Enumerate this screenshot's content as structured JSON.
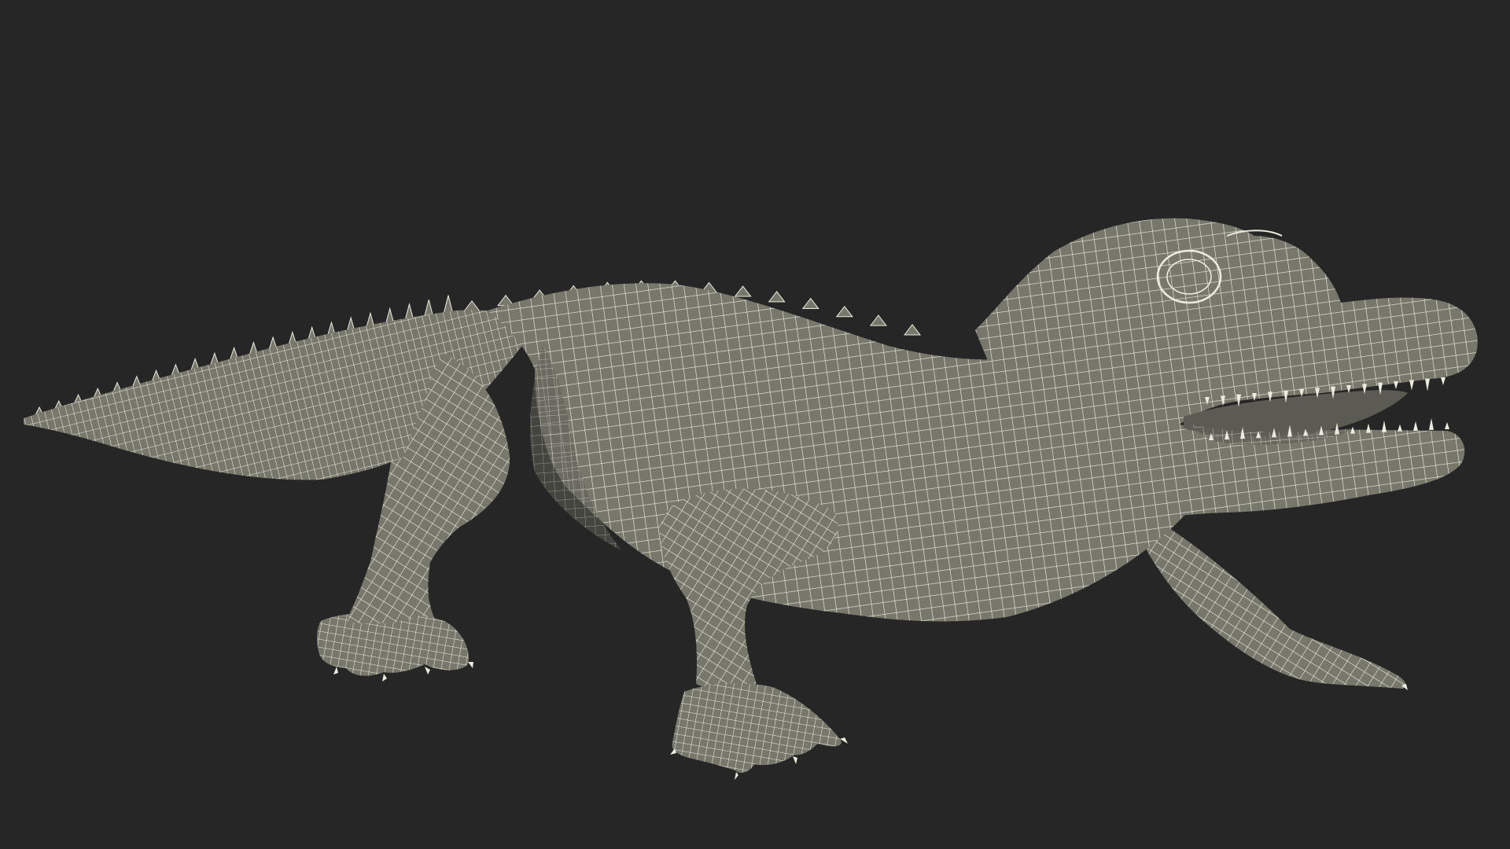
{
  "scene": {
    "subject": "crocodile-wireframe-render",
    "colors": {
      "background": "#262626",
      "mesh_fill": "#77776c",
      "mesh_shadow": "#5f5f56",
      "wire": "#ecebdf"
    }
  }
}
